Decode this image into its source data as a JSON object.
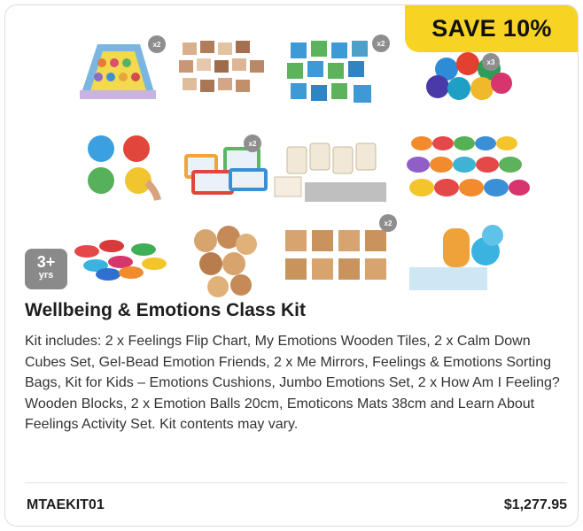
{
  "badge": {
    "label": "SAVE 10%"
  },
  "age": {
    "number": "3+",
    "unit": "yrs"
  },
  "product": {
    "title": "Wellbeing & Emotions Class Kit",
    "description": "Kit includes: 2 x Feelings Flip Chart, My Emotions Wooden Tiles, 2 x Calm Down Cubes Set, Gel-Bead Emotion Friends, 2 x Me Mirrors, Feelings & Emotions Sorting Bags, Kit for Kids – Emotions Cushions, Jumbo Emotions Set, 2 x How Am I Feeling? Wooden Blocks, 2 x Emotion Balls 20cm, Emoticons Mats 38cm and Learn About Feelings Activity Set. Kit contents may vary.",
    "sku": "MTAEKIT01",
    "price": "$1,277.95"
  },
  "gallery": {
    "items": [
      {
        "name": "feelings-flip-chart-image",
        "count": "x2"
      },
      {
        "name": "emotions-wooden-tiles-image",
        "count": ""
      },
      {
        "name": "calm-down-cubes-image",
        "count": "x2"
      },
      {
        "name": "gel-bead-emotion-friends-image",
        "count": "x3"
      },
      {
        "name": "emotion-faces-image",
        "count": ""
      },
      {
        "name": "me-mirrors-image",
        "count": "x2"
      },
      {
        "name": "sorting-bags-image",
        "count": ""
      },
      {
        "name": "emoticon-mats-image",
        "count": ""
      },
      {
        "name": "coloured-mats-image",
        "count": ""
      },
      {
        "name": "emotions-cushions-image",
        "count": ""
      },
      {
        "name": "wooden-blocks-image",
        "count": "x2"
      },
      {
        "name": "emotion-balls-image",
        "count": ""
      }
    ]
  }
}
